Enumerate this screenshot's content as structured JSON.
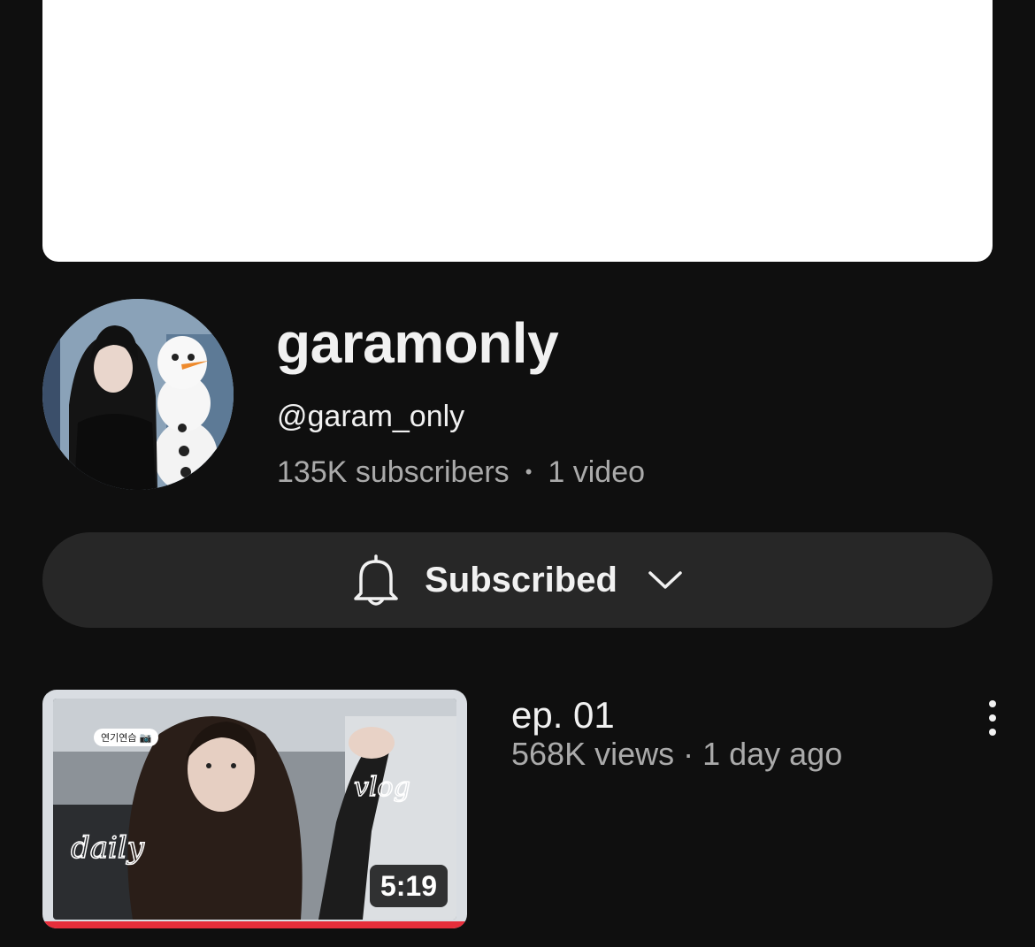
{
  "channel": {
    "name": "garamonly",
    "handle": "@garam_only",
    "subscribers": "135K subscribers",
    "separator": "•",
    "video_count": "1 video"
  },
  "subscribe": {
    "label": "Subscribed",
    "bell_icon": "bell-icon",
    "chevron_icon": "chevron-down-icon"
  },
  "videos": [
    {
      "title": "ep. 01",
      "meta": "568K views · 1 day ago",
      "duration": "5:19",
      "thumbnail_tag": "연기연습 📷",
      "thumbnail_text": "daily vlog",
      "watch_progress": 1.0,
      "more_icon": "more-vertical-icon"
    }
  ],
  "colors": {
    "background": "#0f0f0f",
    "button_bg": "#272727",
    "secondary_text": "#aaaaaa",
    "progress_red": "#e62e3b"
  }
}
